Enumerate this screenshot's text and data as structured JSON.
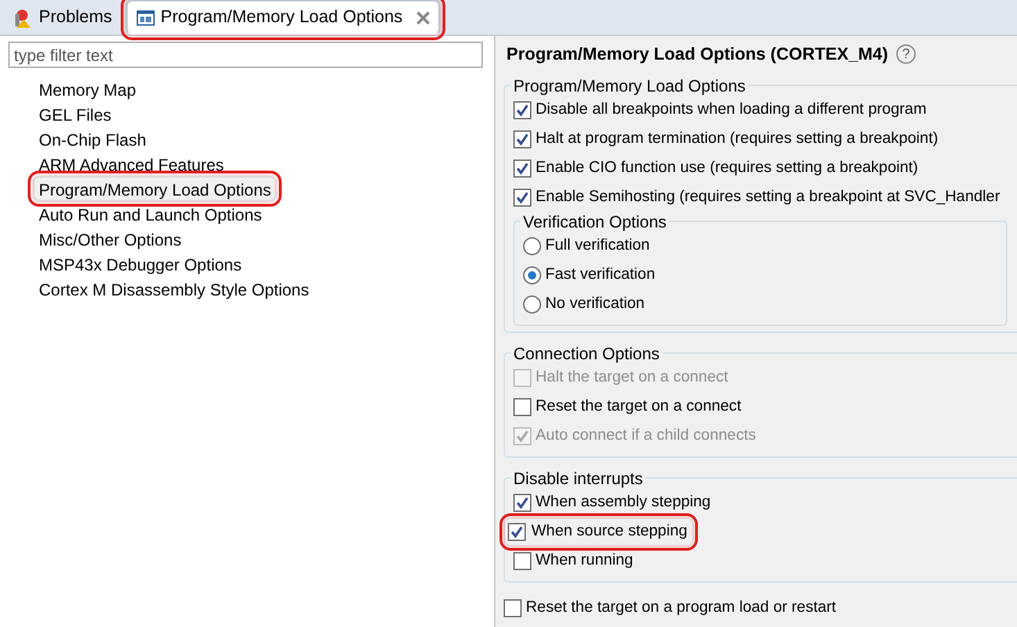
{
  "tabs": [
    {
      "kind": "problems",
      "label": "Problems",
      "selected": false,
      "closable": false,
      "highlighted": false
    },
    {
      "kind": "editor",
      "label": "Program/Memory Load Options",
      "selected": true,
      "closable": true,
      "highlighted": true
    }
  ],
  "filter": {
    "placeholder": "type filter text"
  },
  "tree": [
    {
      "label": "Memory Map",
      "selected": false,
      "highlighted": false
    },
    {
      "label": "GEL Files",
      "selected": false,
      "highlighted": false
    },
    {
      "label": "On-Chip Flash",
      "selected": false,
      "highlighted": false
    },
    {
      "label": "ARM Advanced Features",
      "selected": false,
      "highlighted": false
    },
    {
      "label": "Program/Memory Load Options",
      "selected": true,
      "highlighted": true
    },
    {
      "label": "Auto Run and Launch Options",
      "selected": false,
      "highlighted": false
    },
    {
      "label": "Misc/Other Options",
      "selected": false,
      "highlighted": false
    },
    {
      "label": "MSP43x Debugger Options",
      "selected": false,
      "highlighted": false
    },
    {
      "label": "Cortex M Disassembly Style Options",
      "selected": false,
      "highlighted": false
    }
  ],
  "page": {
    "title": "Program/Memory Load Options (CORTEX_M4)",
    "help": "?",
    "items": [
      {
        "kind": "group",
        "title": "Program/Memory Load Options",
        "items": [
          {
            "kind": "checkbox",
            "label": "Disable all breakpoints when loading a different program",
            "checked": true,
            "disabled": false,
            "highlighted": false
          },
          {
            "kind": "checkbox",
            "label": "Halt at program termination (requires setting a breakpoint)",
            "checked": true,
            "disabled": false,
            "highlighted": false
          },
          {
            "kind": "checkbox",
            "label": "Enable CIO function use (requires setting a breakpoint)",
            "checked": true,
            "disabled": false,
            "highlighted": false
          },
          {
            "kind": "checkbox",
            "label": "Enable Semihosting (requires setting a breakpoint at SVC_Handler",
            "checked": true,
            "disabled": false,
            "highlighted": false
          },
          {
            "kind": "group",
            "title": "Verification Options",
            "items": [
              {
                "kind": "radio",
                "label": "Full verification",
                "selected": false,
                "disabled": false,
                "highlighted": false
              },
              {
                "kind": "radio",
                "label": "Fast verification",
                "selected": true,
                "disabled": false,
                "highlighted": false
              },
              {
                "kind": "radio",
                "label": "No verification",
                "selected": false,
                "disabled": false,
                "highlighted": false
              }
            ]
          }
        ]
      },
      {
        "kind": "group",
        "title": "Connection Options",
        "items": [
          {
            "kind": "checkbox",
            "label": "Halt the target on a connect",
            "checked": false,
            "disabled": true,
            "highlighted": false
          },
          {
            "kind": "checkbox",
            "label": "Reset the target on a connect",
            "checked": false,
            "disabled": false,
            "highlighted": false
          },
          {
            "kind": "checkbox",
            "label": "Auto connect if a child connects",
            "checked": true,
            "disabled": true,
            "highlighted": false
          }
        ]
      },
      {
        "kind": "group",
        "title": "Disable interrupts",
        "items": [
          {
            "kind": "checkbox",
            "label": "When assembly stepping",
            "checked": true,
            "disabled": false,
            "highlighted": false
          },
          {
            "kind": "checkbox",
            "label": "When source stepping",
            "checked": true,
            "disabled": false,
            "highlighted": true
          },
          {
            "kind": "checkbox",
            "label": "When running",
            "checked": false,
            "disabled": false,
            "highlighted": false
          }
        ]
      },
      {
        "kind": "checkbox",
        "label": "Reset the target on a program load or restart",
        "checked": false,
        "disabled": false,
        "highlighted": false
      }
    ]
  }
}
